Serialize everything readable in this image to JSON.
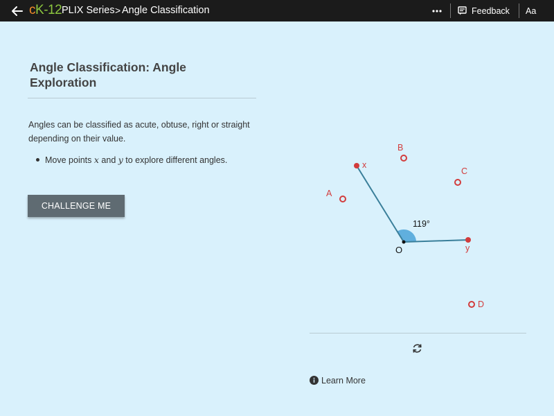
{
  "header": {
    "logo_c": "c",
    "logo_k": "K",
    "logo_rest": "-12",
    "breadcrumb_series": "PLIX Series",
    "breadcrumb_sep": ">",
    "breadcrumb_title": "Angle Classification",
    "feedback_label": "Feedback",
    "font_size_label": "Aa",
    "icons": [
      "back-arrow-icon",
      "more-icon",
      "feedback-icon"
    ]
  },
  "content": {
    "title": "Angle Classification: Angle Exploration",
    "description": "Angles can be classified as acute, obtuse, right or straight depending on their value.",
    "bullet_prefix": "Move points ",
    "bullet_var1": "x",
    "bullet_mid": " and ",
    "bullet_var2": "y",
    "bullet_suffix": " to explore different angles.",
    "challenge_button": "CHALLENGE ME"
  },
  "interactive": {
    "angle_readout": "119°",
    "vertex_label": "O",
    "draggable_points": [
      {
        "name": "x"
      },
      {
        "name": "y"
      }
    ],
    "reference_points": [
      {
        "name": "A"
      },
      {
        "name": "B"
      },
      {
        "name": "C"
      },
      {
        "name": "D"
      }
    ]
  },
  "footer": {
    "learn_more_label": "Learn More",
    "icons": [
      "reset-icon",
      "info-icon"
    ]
  },
  "colors": {
    "background": "#d9f1fc",
    "topbar": "#1b1b1b",
    "point_red": "#d23c3c",
    "ray": "#3a7f9a",
    "angle_fill": "#4aa3d8",
    "button": "#5f6b72"
  }
}
